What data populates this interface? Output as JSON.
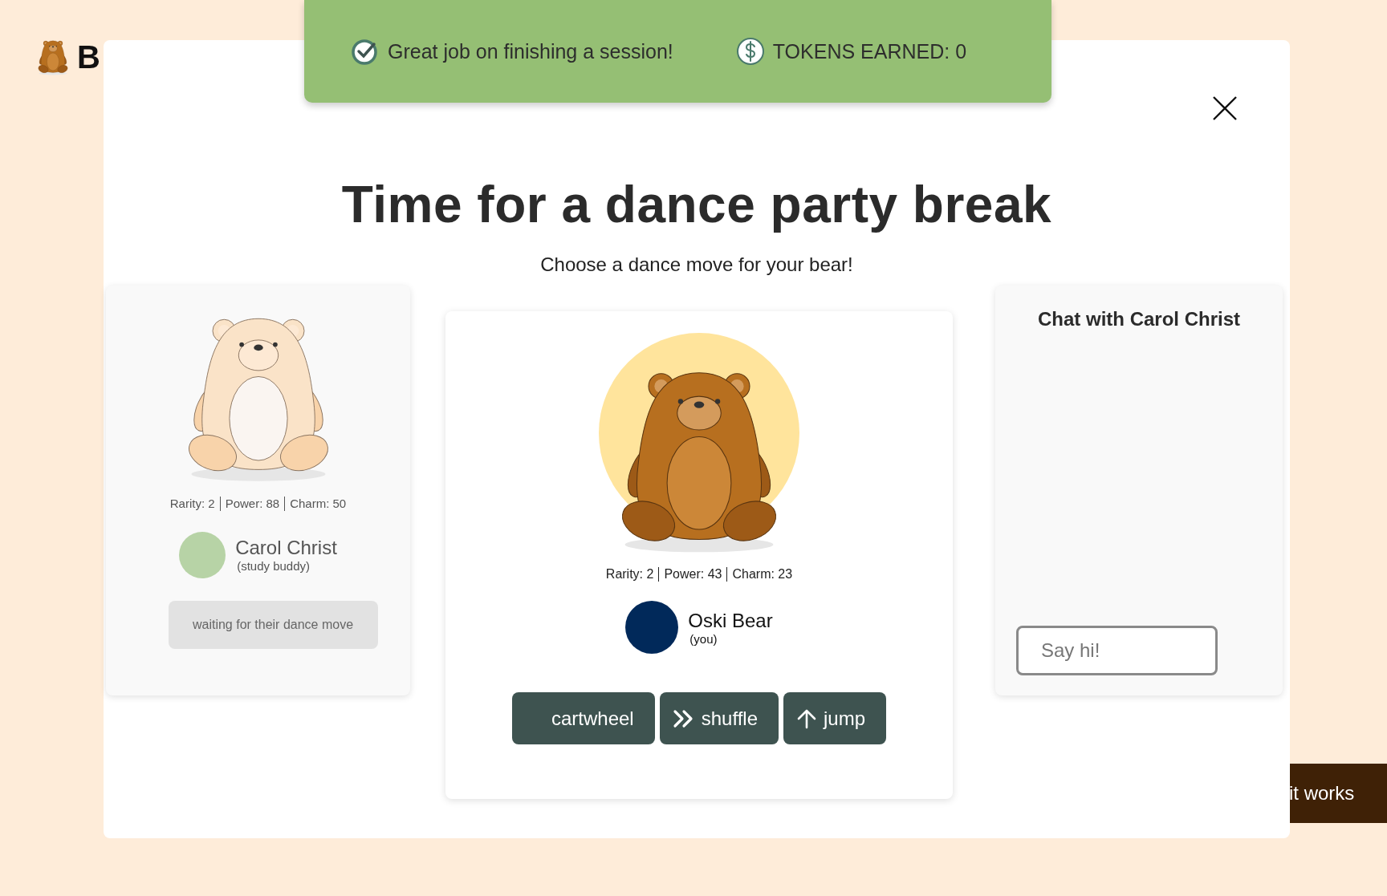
{
  "header": {
    "logo_text": "B"
  },
  "toast": {
    "message": "Great job on finishing a session!",
    "tokens": "TOKENS EARNED: 0"
  },
  "modal": {
    "title": "Time for a dance party break",
    "subtitle": "Choose a dance move for your bear!"
  },
  "buddy": {
    "stats": [
      "Rarity: 2",
      "Power: 88",
      "Charm: 50"
    ],
    "name": "Carol Christ",
    "role": "(study buddy)",
    "color": "#b7d3a6",
    "status": "waiting for their dance move"
  },
  "player": {
    "stats": [
      "Rarity: 2",
      "Power: 43",
      "Charm: 23"
    ],
    "name": "Oski Bear",
    "role": "(you)",
    "color": "#01295a"
  },
  "moves": [
    {
      "label": "cartwheel",
      "kind": "blank"
    },
    {
      "label": "shuffle",
      "kind": "chevrons"
    },
    {
      "label": "jump",
      "kind": "arrow-up"
    }
  ],
  "chat": {
    "title": "Chat with Carol Christ",
    "placeholder": "Say hi!"
  },
  "help_button": {
    "label": "it works"
  }
}
